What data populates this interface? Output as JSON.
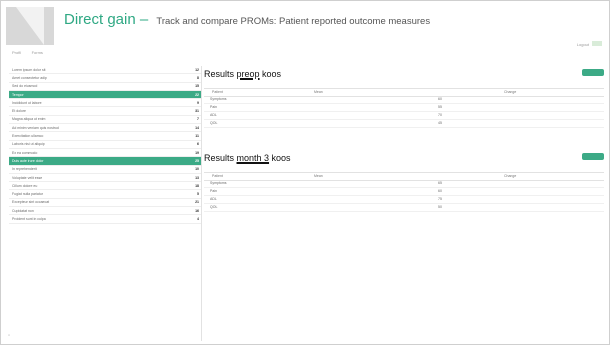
{
  "header": {
    "title": "Direct gain",
    "separator": " – ",
    "subtitle": "Track and compare PROMs: Patient reported outcome measures"
  },
  "top_nav": {
    "left_items": [
      "Profil",
      "Forms"
    ],
    "right_item": "Logout"
  },
  "sidebar": {
    "items": [
      {
        "name": "Lorem ipsum dolor sit",
        "count": "12"
      },
      {
        "name": "Amet consectetur adip",
        "count": "8"
      },
      {
        "name": "Sed do eiusmod",
        "count": "15"
      },
      {
        "name": "Tempor",
        "count": "22",
        "active": true
      },
      {
        "name": "Incididunt ut labore",
        "count": "9"
      },
      {
        "name": "Et dolore",
        "count": "31"
      },
      {
        "name": "Magna aliqua ut enim",
        "count": "7"
      },
      {
        "name": "Ad minim veniam quis nostrud",
        "count": "14"
      },
      {
        "name": "Exercitation ullamco",
        "count": "11"
      },
      {
        "name": "Laboris nisi ut aliquip",
        "count": "6"
      },
      {
        "name": "Ex ea commodo",
        "count": "19"
      },
      {
        "name": "Duis aute irure dolor",
        "count": "25",
        "active": true
      },
      {
        "name": "In reprehenderit",
        "count": "10"
      },
      {
        "name": "Voluptate velit esse",
        "count": "13"
      },
      {
        "name": "Cillum dolore eu",
        "count": "18"
      },
      {
        "name": "Fugiat nulla pariatur",
        "count": "5"
      },
      {
        "name": "Excepteur sint occaecat",
        "count": "21"
      },
      {
        "name": "Cupidatat non",
        "count": "16"
      },
      {
        "name": "Proident sunt in culpa",
        "count": "4"
      }
    ]
  },
  "panels": [
    {
      "prefix": "Results ",
      "period": "preop",
      "suffix": " koos",
      "columns": [
        "Patient",
        "Mean",
        "Change"
      ],
      "rows": [
        {
          "label": "Symptoms",
          "value": "60"
        },
        {
          "label": "Pain",
          "value": "55"
        },
        {
          "label": "ADL",
          "value": "70"
        },
        {
          "label": "QOL",
          "value": "45"
        }
      ]
    },
    {
      "prefix": "Results ",
      "period": "month 3",
      "suffix": " koos",
      "columns": [
        "Patient",
        "Mean",
        "Change"
      ],
      "rows": [
        {
          "label": "Symptoms",
          "value": "65"
        },
        {
          "label": "Pain",
          "value": "60"
        },
        {
          "label": "ADL",
          "value": "75"
        },
        {
          "label": "QOL",
          "value": "50"
        }
      ]
    }
  ],
  "colors": {
    "accent": "#3caa86",
    "title": "#2ea883"
  }
}
